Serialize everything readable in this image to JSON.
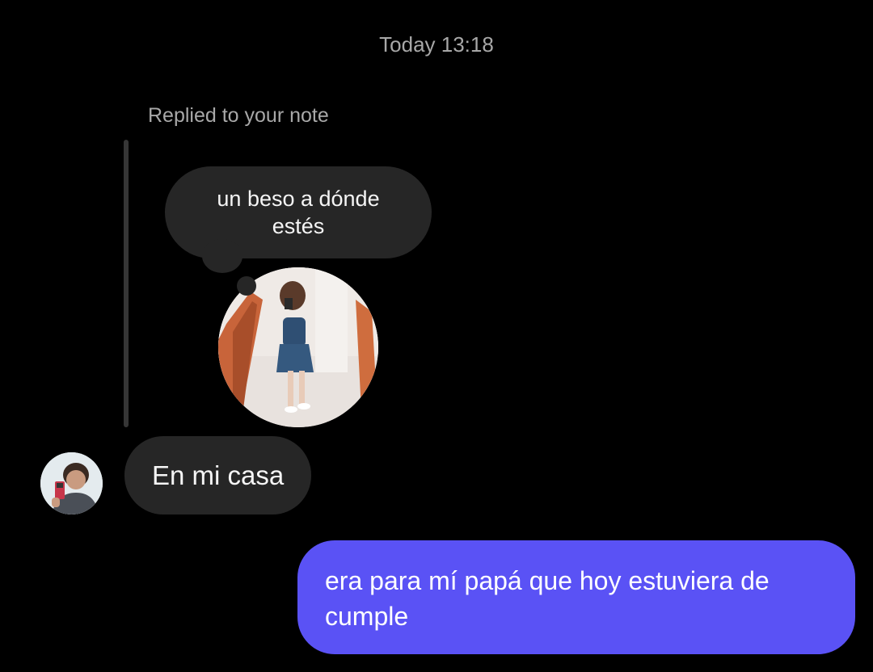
{
  "conversation": {
    "timestamp": "Today 13:18",
    "reply_caption": "Replied to your note",
    "note": {
      "text": "un beso a dónde estés"
    },
    "messages": [
      {
        "sender": "them",
        "text": "En mi casa"
      },
      {
        "sender": "me",
        "text": "era para mí papá que hoy estuviera de cumple"
      }
    ]
  },
  "colors": {
    "background": "#000000",
    "received_bubble": "#262626",
    "sent_bubble": "#5a52f5",
    "muted_text": "#a8a8a8"
  }
}
